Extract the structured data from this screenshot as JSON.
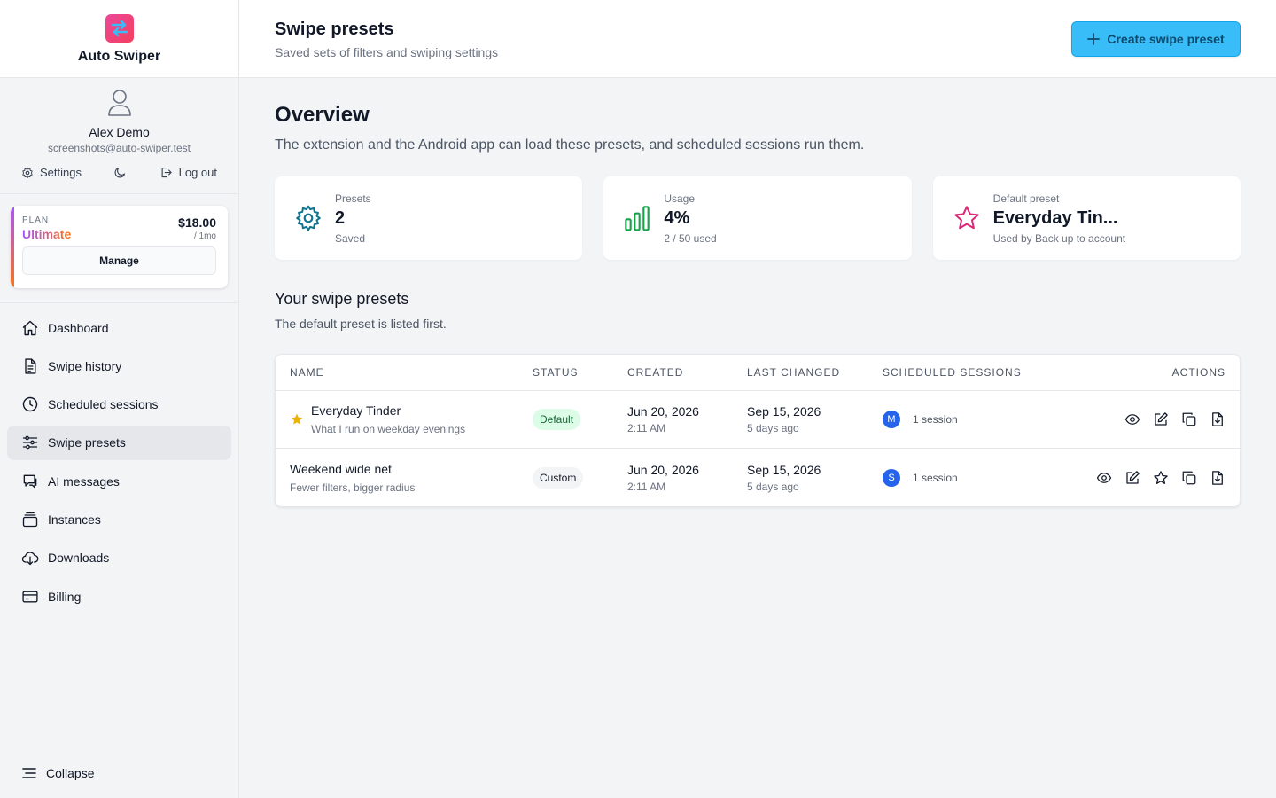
{
  "brand": {
    "name": "Auto Swiper"
  },
  "user": {
    "name": "Alex Demo",
    "email": "screenshots@auto-swiper.test"
  },
  "profile_actions": {
    "settings": "Settings",
    "logout": "Log out"
  },
  "plan": {
    "label": "PLAN",
    "name": "Ultimate",
    "price": "$18.00",
    "period": "/ 1mo",
    "manage": "Manage"
  },
  "nav": [
    {
      "label": "Dashboard",
      "icon": "home-icon"
    },
    {
      "label": "Swipe history",
      "icon": "document-icon"
    },
    {
      "label": "Scheduled sessions",
      "icon": "clock-icon"
    },
    {
      "label": "Swipe presets",
      "icon": "sliders-icon",
      "active": true
    },
    {
      "label": "AI messages",
      "icon": "chat-icon"
    },
    {
      "label": "Instances",
      "icon": "stack-icon"
    },
    {
      "label": "Downloads",
      "icon": "cloud-download-icon"
    },
    {
      "label": "Billing",
      "icon": "credit-card-icon"
    }
  ],
  "collapse": "Collapse",
  "header": {
    "title": "Swipe presets",
    "subtitle": "Saved sets of filters and swiping settings",
    "create": "Create swipe preset"
  },
  "overview": {
    "title": "Overview",
    "subtitle": "The extension and the Android app can load these presets, and scheduled sessions run them."
  },
  "stats": [
    {
      "label": "Presets",
      "value": "2",
      "desc": "Saved",
      "icon": "gear-icon",
      "color": "#0e7490"
    },
    {
      "label": "Usage",
      "value": "4%",
      "desc": "2 / 50 used",
      "icon": "bar-chart-icon",
      "color": "#16a34a"
    },
    {
      "label": "Default preset",
      "value": "Everyday Tin...",
      "desc": "Used by Back up to account",
      "icon": "star-icon",
      "color": "#db2777"
    }
  ],
  "presets_section": {
    "title": "Your swipe presets",
    "subtitle": "The default preset is listed first."
  },
  "table": {
    "headers": {
      "name": "NAME",
      "status": "STATUS",
      "created": "CREATED",
      "changed": "LAST CHANGED",
      "scheduled": "SCHEDULED SESSIONS",
      "actions": "ACTIONS"
    },
    "rows": [
      {
        "name": "Everyday Tinder",
        "desc": "What I run on weekday evenings",
        "status": "Default",
        "created_date": "Jun 20, 2026",
        "created_time": "2:11 AM",
        "changed_date": "Sep 15, 2026",
        "changed_ago": "5 days ago",
        "avatar": "M",
        "sessions": "1 session"
      },
      {
        "name": "Weekend wide net",
        "desc": "Fewer filters, bigger radius",
        "status": "Custom",
        "created_date": "Jun 20, 2026",
        "created_time": "2:11 AM",
        "changed_date": "Sep 15, 2026",
        "changed_ago": "5 days ago",
        "avatar": "S",
        "sessions": "1 session"
      }
    ]
  },
  "colors": {
    "accent": "#38bdf8",
    "default_star": "#eab308",
    "avatar": "#2563eb"
  }
}
